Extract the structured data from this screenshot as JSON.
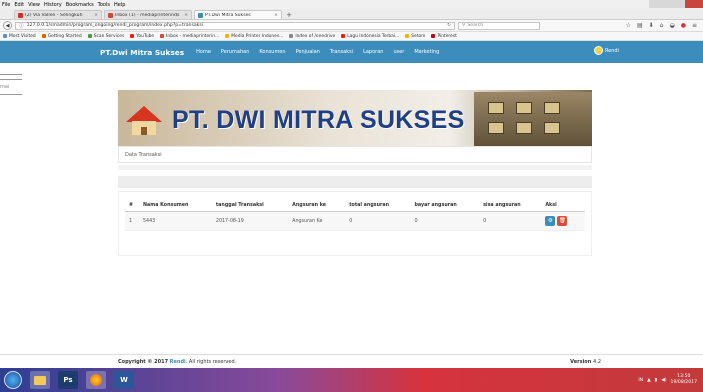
{
  "menubar": {
    "items": [
      "File",
      "Edit",
      "View",
      "History",
      "Bookmarks",
      "Tools",
      "Help"
    ]
  },
  "tabs": [
    {
      "label": "(2) Via Vallen - Selingkuh",
      "color": "#d62d20"
    },
    {
      "label": "Inbox (1) - mediaprinterinds",
      "color": "#d14836"
    },
    {
      "label": "PT.Dwi Mitra Sukses",
      "color": "#3c8dbc"
    }
  ],
  "navbar": {
    "url": "127.0.0.1/smadmin/program_ongoing/rendi_program/index.php?p=transaksi",
    "search_placeholder": "Search"
  },
  "bookmarks": [
    {
      "label": "Most Visited",
      "color": "#5a8fd6"
    },
    {
      "label": "Getting Started",
      "color": "#e66000"
    },
    {
      "label": "Scan Services",
      "color": "#4a9a4a"
    },
    {
      "label": "YouTube",
      "color": "#e62117"
    },
    {
      "label": "Inbox - mediaprinterin...",
      "color": "#d14836"
    },
    {
      "label": "Media Printer Indones...",
      "color": "#f4b400"
    },
    {
      "label": "Index of /onedrive",
      "color": "#888888"
    },
    {
      "label": "Lagu Indonesia Terbai...",
      "color": "#e62117"
    },
    {
      "label": "Setom",
      "color": "#f4b400"
    },
    {
      "label": "Pinterest",
      "color": "#bd081c"
    }
  ],
  "app": {
    "brand": "PT.Dwi Mitra Sukses",
    "menu": [
      "Home",
      "Perumahan",
      "Konsumen",
      "Penjualan",
      "Transaksi",
      "Laporan",
      "user",
      "Marketing"
    ],
    "user": "Rendi"
  },
  "side_widget": {
    "label": "mai"
  },
  "banner": {
    "title": "PT. DWI MITRA SUKSES"
  },
  "breadcrumb": "Data Transaksi",
  "table": {
    "headers": [
      "#",
      "Nama Konsumen",
      "tanggal Transaksi",
      "Angsuran ke",
      "total angsuran",
      "bayar angsuran",
      "sisa angsuran",
      "Aksi"
    ],
    "rows": [
      {
        "no": "1",
        "nama": "5443",
        "tanggal": "2017-08-19",
        "angsuran_ke": "Angsuran Ke",
        "total": "0",
        "bayar": "0",
        "sisa": "0"
      }
    ]
  },
  "footer": {
    "copyright_prefix": "Copyright © 2017",
    "author": "Rendi",
    "rights": ". All rights reserved.",
    "version_label": "Version",
    "version": "4.2"
  },
  "taskbar": {
    "apps": [
      "Ps",
      "W"
    ],
    "time": "13:50",
    "date": "19/08/2017"
  }
}
